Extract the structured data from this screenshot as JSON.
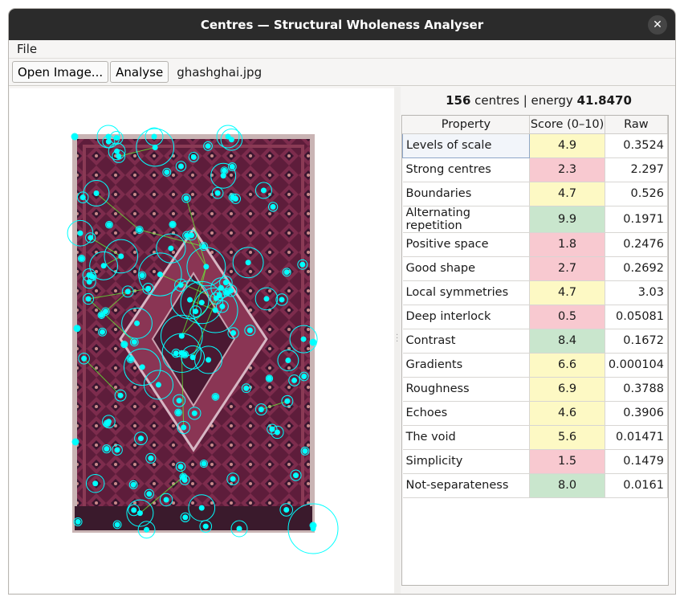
{
  "window": {
    "title": "Centres — Structural Wholeness Analyser",
    "close_glyph": "✕"
  },
  "menu": {
    "file": "File"
  },
  "toolbar": {
    "open_label": "Open Image...",
    "analyse_label": "Analyse",
    "filename": "ghashghai.jpg"
  },
  "summary": {
    "count": "156",
    "count_label": "centres",
    "separator": "|",
    "energy_label": "energy",
    "energy": "41.8470"
  },
  "table": {
    "headers": [
      "Property",
      "Score (0–10)",
      "Raw"
    ],
    "rows": [
      {
        "property": "Levels of scale",
        "score": "4.9",
        "raw": "0.3524",
        "band": "mid"
      },
      {
        "property": "Strong centres",
        "score": "2.3",
        "raw": "2.297",
        "band": "bad"
      },
      {
        "property": "Boundaries",
        "score": "4.7",
        "raw": "0.526",
        "band": "mid"
      },
      {
        "property": "Alternating repetition",
        "score": "9.9",
        "raw": "0.1971",
        "band": "good"
      },
      {
        "property": "Positive space",
        "score": "1.8",
        "raw": "0.2476",
        "band": "bad"
      },
      {
        "property": "Good shape",
        "score": "2.7",
        "raw": "0.2692",
        "band": "bad"
      },
      {
        "property": "Local symmetries",
        "score": "4.7",
        "raw": "3.03",
        "band": "mid"
      },
      {
        "property": "Deep interlock",
        "score": "0.5",
        "raw": "0.05081",
        "band": "bad"
      },
      {
        "property": "Contrast",
        "score": "8.4",
        "raw": "0.1672",
        "band": "good"
      },
      {
        "property": "Gradients",
        "score": "6.6",
        "raw": "0.000104",
        "band": "mid"
      },
      {
        "property": "Roughness",
        "score": "6.9",
        "raw": "0.3788",
        "band": "mid"
      },
      {
        "property": "Echoes",
        "score": "4.6",
        "raw": "0.3906",
        "band": "mid"
      },
      {
        "property": "The void",
        "score": "5.6",
        "raw": "0.01471",
        "band": "mid"
      },
      {
        "property": "Simplicity",
        "score": "1.5",
        "raw": "0.1479",
        "band": "bad"
      },
      {
        "property": "Not-separateness",
        "score": "8.0",
        "raw": "0.0161",
        "band": "good"
      }
    ]
  },
  "colors": {
    "good": "#c9e6cd",
    "mid": "#fdf9c4",
    "bad": "#f8c9d0",
    "centre": "#00ffff",
    "edge": "#66ff33",
    "rug": "#6b2040"
  },
  "icons": [
    "close-icon",
    "splitter-handle-icon"
  ]
}
